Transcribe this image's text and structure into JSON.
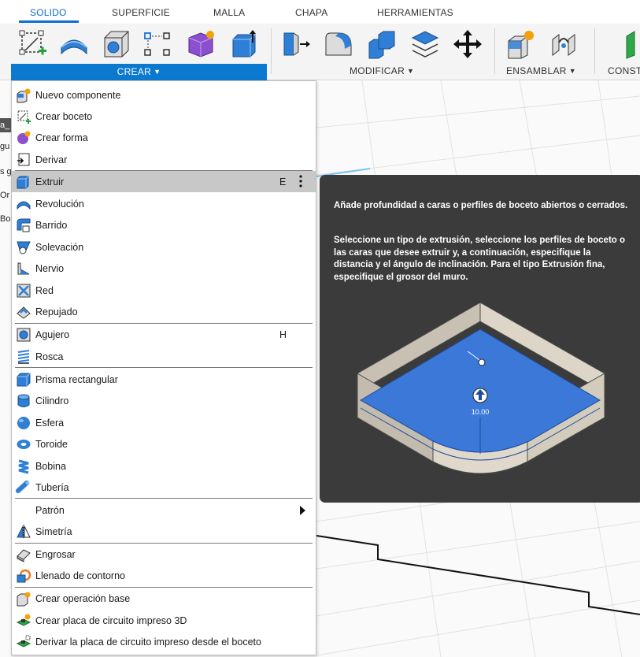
{
  "tabs": [
    {
      "label": "SOLIDO",
      "active": true
    },
    {
      "label": "SUPERFICIE"
    },
    {
      "label": "MALLA"
    },
    {
      "label": "CHAPA"
    },
    {
      "label": "HERRAMIENTAS"
    }
  ],
  "toolbar": {
    "groups": {
      "crear": "CREAR",
      "modificar": "MODIFICAR",
      "ensamblar": "ENSAMBLAR",
      "construir": "CONST"
    }
  },
  "sidebar_stub": [
    "a_",
    "gu",
    "s g",
    "Or",
    "Bo"
  ],
  "menu": {
    "items": [
      {
        "label": "Nuevo componente",
        "icon": "new-component-icon"
      },
      {
        "label": "Crear boceto",
        "icon": "create-sketch-icon"
      },
      {
        "label": "Crear forma",
        "icon": "create-form-icon"
      },
      {
        "label": "Derivar",
        "icon": "derive-icon"
      },
      {
        "label": "Extruir",
        "icon": "extrude-icon",
        "shortcut": "E",
        "highlighted": true
      },
      {
        "label": "Revolución",
        "icon": "revolve-icon"
      },
      {
        "label": "Barrido",
        "icon": "sweep-icon"
      },
      {
        "label": "Solevación",
        "icon": "loft-icon"
      },
      {
        "label": "Nervio",
        "icon": "rib-icon"
      },
      {
        "label": "Red",
        "icon": "web-icon"
      },
      {
        "label": "Repujado",
        "icon": "emboss-icon"
      },
      {
        "label": "Agujero",
        "icon": "hole-icon",
        "shortcut": "H"
      },
      {
        "label": "Rosca",
        "icon": "thread-icon"
      },
      {
        "label": "Prisma rectangular",
        "icon": "box-icon"
      },
      {
        "label": "Cilindro",
        "icon": "cylinder-icon"
      },
      {
        "label": "Esfera",
        "icon": "sphere-icon"
      },
      {
        "label": "Toroide",
        "icon": "torus-icon"
      },
      {
        "label": "Bobina",
        "icon": "coil-icon"
      },
      {
        "label": "Tubería",
        "icon": "pipe-icon"
      },
      {
        "label": "Patrón",
        "icon": "",
        "submenu": true
      },
      {
        "label": "Simetría",
        "icon": "mirror-icon"
      },
      {
        "label": "Engrosar",
        "icon": "thicken-icon"
      },
      {
        "label": "Llenado de contorno",
        "icon": "boundary-fill-icon"
      },
      {
        "label": "Crear operación base",
        "icon": "base-feature-icon"
      },
      {
        "label": "Crear placa de circuito impreso 3D",
        "icon": "pcb-3d-icon"
      },
      {
        "label": "Derivar la placa de circuito impreso desde el boceto",
        "icon": "pcb-from-sketch-icon"
      }
    ]
  },
  "tooltip": {
    "paragraph1": "Añade profundidad a caras o perfiles de boceto abiertos o cerrados.",
    "paragraph2": "Seleccione un tipo de extrusión, seleccione los perfiles de boceto o las caras que desee extruir y, a continuación, especifique la distancia y el ángulo de inclinación. Para el tipo Extrusión fina, especifique el grosor del muro.",
    "dimension_value": "10.00"
  },
  "colors": {
    "accent": "#0b79d0",
    "tooltip_bg": "#3b3b3b",
    "highlight": "#c8c8c8"
  }
}
